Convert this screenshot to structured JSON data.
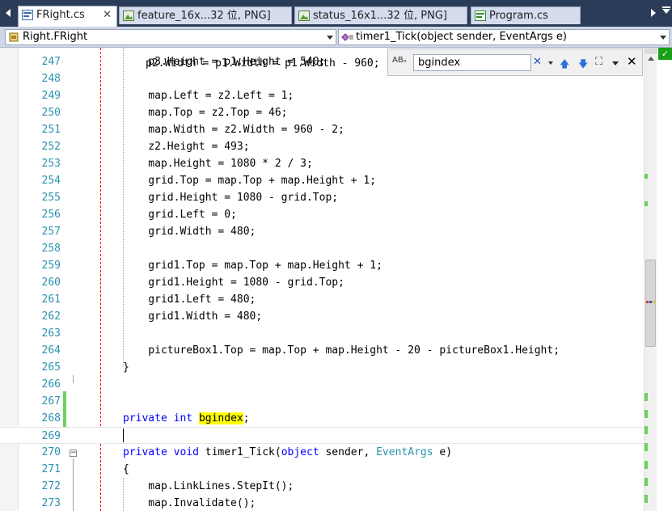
{
  "tabs": [
    {
      "label": "FRight.cs",
      "icon": "csharp-file-icon",
      "active": true,
      "close": "✕"
    },
    {
      "label": "feature_16x...32 位, PNG]",
      "icon": "image-file-icon",
      "active": false
    },
    {
      "label": "status_16x1...32 位, PNG]",
      "icon": "image-file-icon",
      "active": false
    },
    {
      "label": "Program.cs",
      "icon": "csharp-file-icon",
      "active": false
    }
  ],
  "navbar": {
    "type_combo": "Right.FRight",
    "member_combo": "timer1_Tick(object sender, EventArgs e)"
  },
  "find": {
    "option_label": "ABₒ",
    "value": "bgindex",
    "clear": "✕",
    "close": "✕"
  },
  "lines": [
    {
      "n": "247",
      "text": "    p3.Height = p1.Height = 540;"
    },
    {
      "n": "248",
      "text": ""
    },
    {
      "n": "249",
      "text": "    map.Left = z2.Left = 1;"
    },
    {
      "n": "250",
      "text": "    map.Top = z2.Top = 46;"
    },
    {
      "n": "251",
      "text": "    map.Width = z2.Width = 960 - 2;"
    },
    {
      "n": "252",
      "text": "    z2.Height = 493;"
    },
    {
      "n": "253",
      "text": "    map.Height = 1080 * 2 / 3;"
    },
    {
      "n": "254",
      "text": "    grid.Top = map.Top + map.Height + 1;"
    },
    {
      "n": "255",
      "text": "    grid.Height = 1080 - grid.Top;"
    },
    {
      "n": "256",
      "text": "    grid.Left = 0;"
    },
    {
      "n": "257",
      "text": "    grid.Width = 480;"
    },
    {
      "n": "258",
      "text": ""
    },
    {
      "n": "259",
      "text": "    grid1.Top = map.Top + map.Height + 1;"
    },
    {
      "n": "260",
      "text": "    grid1.Height = 1080 - grid.Top;"
    },
    {
      "n": "261",
      "text": "    grid1.Left = 480;"
    },
    {
      "n": "262",
      "text": "    grid1.Width = 480;"
    },
    {
      "n": "263",
      "text": ""
    },
    {
      "n": "264",
      "text": "    pictureBox1.Top = map.Top + map.Height - 20 - pictureBox1.Height;"
    },
    {
      "n": "265",
      "text": "}"
    },
    {
      "n": "266",
      "text": ""
    },
    {
      "n": "267",
      "text": ""
    },
    {
      "n": "268",
      "kw1": "private",
      "kw2": "int",
      "hl": "bgindex",
      "rest": ";"
    },
    {
      "n": "269",
      "text": ""
    },
    {
      "n": "270",
      "kw1": "private",
      "kw2": "void",
      "sig1": " timer1_Tick(",
      "kw3": "object",
      "sig2": " sender, ",
      "ty": "EventArgs",
      "sig3": " e)"
    },
    {
      "n": "271",
      "text": "{"
    },
    {
      "n": "272",
      "text": "    map.LinkLines.StepIt();"
    },
    {
      "n": "273",
      "text": "    map.Invalidate();"
    }
  ],
  "partial_line_text": "p2.Width = p1.Width = p1.Width - 960;",
  "colors": {
    "tabstrip": "#2b3c59",
    "keyword": "#0000ff",
    "type": "#2b91af",
    "line_number": "#2b91af",
    "find_highlight": "#ffff00",
    "change_bar": "#6ad35a"
  }
}
